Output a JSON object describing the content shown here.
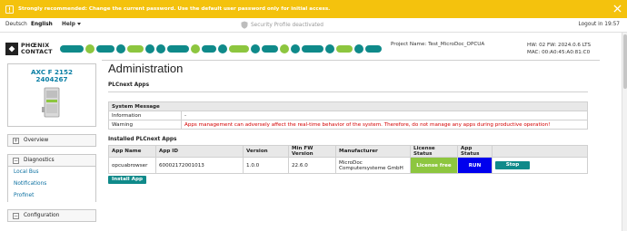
{
  "warning": {
    "text": "Strongly recommended: Change the current password. Use the default user password only for initial access."
  },
  "topbar": {
    "lang_de": "Deutsch",
    "lang_en": "English",
    "help": "Help",
    "security_profile": "Security Profile deactivated",
    "logout": "Logout in 19:57"
  },
  "header": {
    "logo_line1": "PHŒNIX",
    "logo_line2": "CONTACT",
    "project": "Project Name: Test_MicroDoc_OPCUA",
    "hw_fw": "HW: 02 FW: 2024.0.6 LTS",
    "mac": "MAC: 00:A0:45:A0:81:C0"
  },
  "sidebar": {
    "device_line1": "AXC F 2152",
    "device_line2": "2404267",
    "overview": "Overview",
    "diagnostics": "Diagnostics",
    "links": [
      "Local Bus",
      "Notifications",
      "Profinet"
    ],
    "configuration": "Configuration"
  },
  "main": {
    "title": "Administration",
    "subtitle": "PLCnext Apps",
    "system_message": {
      "header": "System Message",
      "rows": [
        {
          "label": "Information",
          "value": "-"
        },
        {
          "label": "Warning",
          "value": "Apps management can adversely affect the real-time behavior of the system. Therefore, do not manage any apps during productive operation!"
        }
      ]
    },
    "installed_title": "Installed PLCnext Apps",
    "columns": [
      "App Name",
      "App ID",
      "Version",
      "Min FW Version",
      "Manufacturer",
      "License Status",
      "App Status"
    ],
    "apps": [
      {
        "name": "opcuabrowser",
        "id": "60002172001013",
        "version": "1.0.0",
        "min_fw": "22.6.0",
        "manufacturer": "MicroDoc Computersysteme GmbH",
        "license": "License free",
        "status": "RUN",
        "action": "Stop"
      }
    ],
    "install_button": "Install App"
  },
  "colors": {
    "warning_bg": "#f4c20d",
    "teal": "#0f8a8a",
    "license_green": "#8dc63f",
    "run_blue": "#0000ee",
    "red_text": "#d40000",
    "link_blue": "#0a6fa0"
  }
}
